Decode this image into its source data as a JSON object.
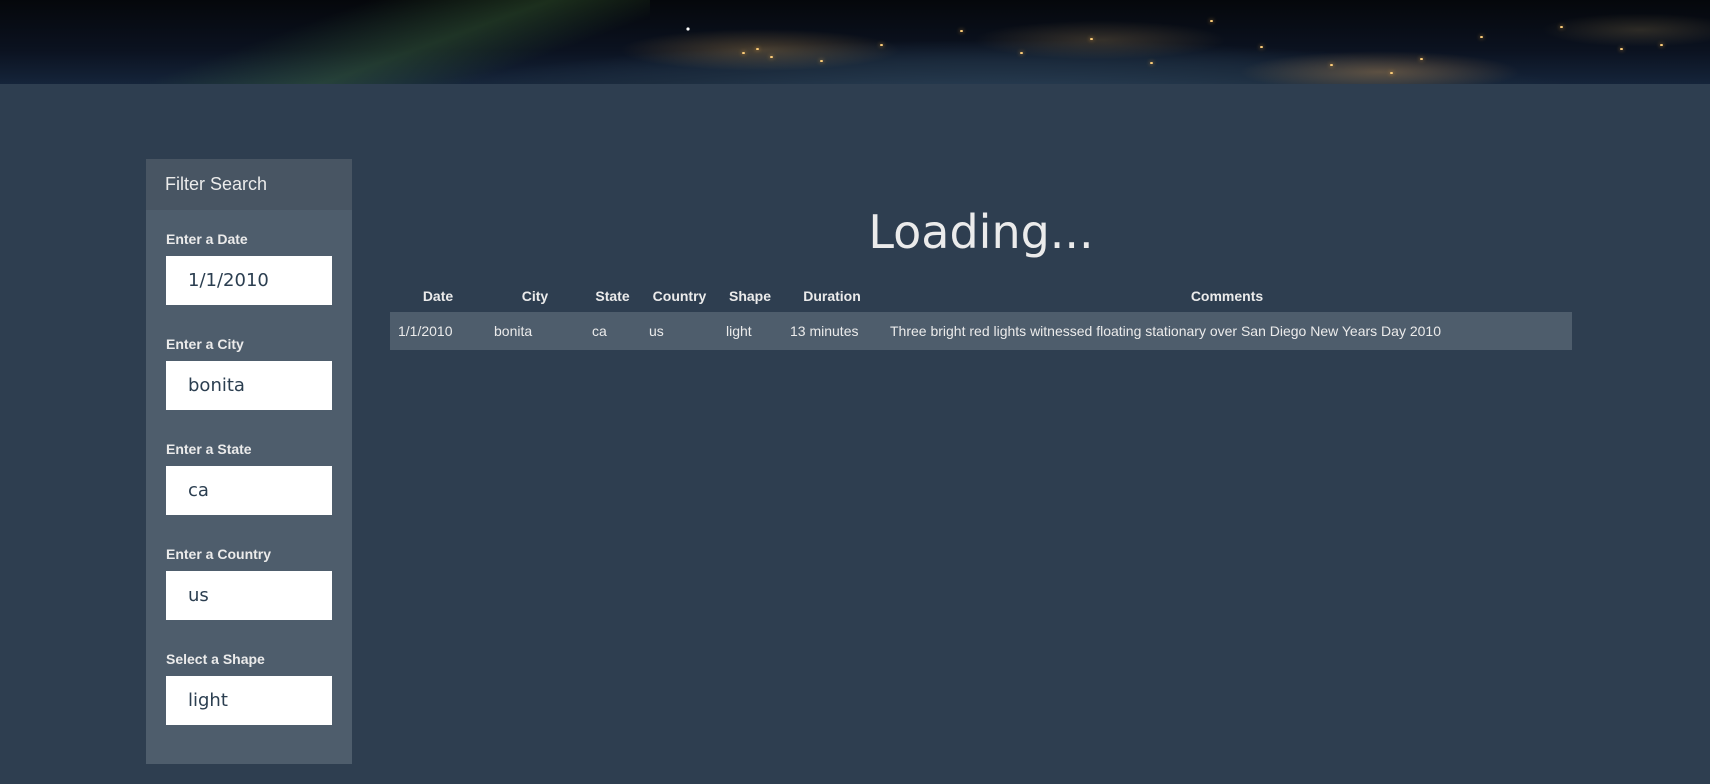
{
  "page": {
    "title": "Loading..."
  },
  "filters": {
    "header": "Filter Search",
    "date": {
      "label": "Enter a Date",
      "value": "1/1/2010"
    },
    "city": {
      "label": "Enter a City",
      "value": "bonita"
    },
    "state": {
      "label": "Enter a State",
      "value": "ca"
    },
    "country": {
      "label": "Enter a Country",
      "value": "us"
    },
    "shape": {
      "label": "Select a Shape",
      "value": "light"
    }
  },
  "table": {
    "headers": [
      "Date",
      "City",
      "State",
      "Country",
      "Shape",
      "Duration",
      "Comments"
    ],
    "rows": [
      [
        "1/1/2010",
        "bonita",
        "ca",
        "us",
        "light",
        "13 minutes",
        "Three bright red lights witnessed floating stationary over San Diego New Years Day 2010"
      ]
    ]
  },
  "colors": {
    "background": "#2e3e50",
    "panel": "#4e5d6c",
    "panel_header": "#485563",
    "text": "#ebebeb"
  }
}
